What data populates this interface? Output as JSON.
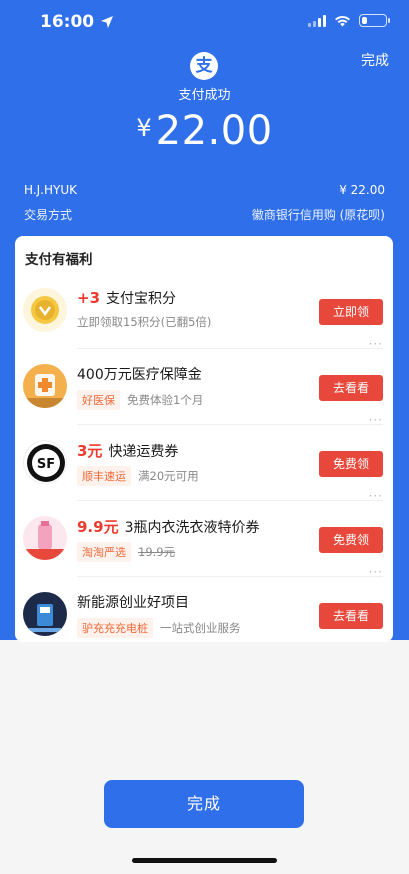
{
  "status_bar": {
    "time": "16:00",
    "battery_percent": 25
  },
  "header": {
    "done_label": "完成",
    "logo_char": "支",
    "pay_status": "支付成功",
    "currency": "¥",
    "amount": "22.00",
    "payee": "H.J.HYUK",
    "payee_amount": "¥ 22.00",
    "method_label": "交易方式",
    "method_value": "徽商银行信用购 (原花呗)"
  },
  "benefits": {
    "title": "支付有福利",
    "more": "···",
    "items": [
      {
        "highlight": "+3",
        "title": "支付宝积分",
        "tag": "",
        "desc": "立即领取15积分(已翻5倍)",
        "strike": "",
        "button": "立即领",
        "icon": "points-icon"
      },
      {
        "highlight": "",
        "title": "400万元医疗保障金",
        "tag": "好医保",
        "desc": "免费体验1个月",
        "strike": "",
        "button": "去看看",
        "icon": "insurance-icon"
      },
      {
        "highlight": "3元",
        "title": "快递运费券",
        "tag": "顺丰速运",
        "desc": "满20元可用",
        "strike": "",
        "button": "免费领",
        "icon": "sf-express-icon"
      },
      {
        "highlight": "9.9元",
        "title": "3瓶内衣洗衣液特价券",
        "tag": "淘淘严选",
        "desc": "",
        "strike": "19.9元",
        "button": "免费领",
        "icon": "laundry-product-icon"
      },
      {
        "highlight": "",
        "title": "新能源创业好项目",
        "tag": "驴充充充电桩",
        "desc": "一站式创业服务",
        "strike": "",
        "button": "去看看",
        "icon": "charging-station-icon"
      }
    ]
  },
  "footer": {
    "done_label": "完成"
  }
}
